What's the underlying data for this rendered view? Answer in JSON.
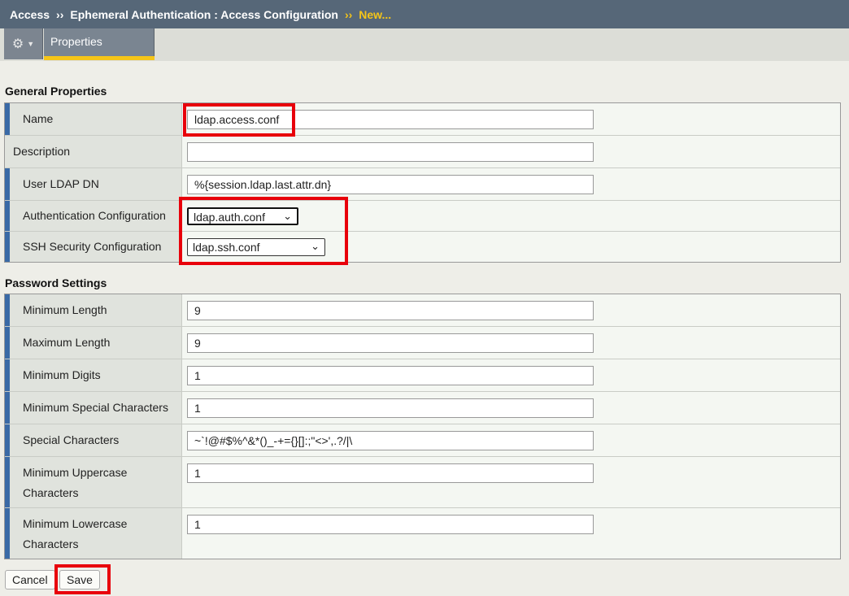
{
  "breadcrumb": {
    "root": "Access",
    "separator": "››",
    "parent": "Ephemeral Authentication : Access Configuration",
    "current": "New..."
  },
  "tabs": {
    "gear_icon": "gear-icon",
    "active_label": "Properties"
  },
  "general": {
    "title": "General Properties",
    "name_label": "Name",
    "name_value": "ldap.access.conf",
    "description_label": "Description",
    "description_value": "",
    "user_ldap_dn_label": "User LDAP DN",
    "user_ldap_dn_value": "%{session.ldap.last.attr.dn}",
    "auth_config_label": "Authentication Configuration",
    "auth_config_value": "ldap.auth.conf",
    "ssh_config_label": "SSH Security Configuration",
    "ssh_config_value": "ldap.ssh.conf"
  },
  "password": {
    "title": "Password Settings",
    "min_length_label": "Minimum Length",
    "min_length_value": "9",
    "max_length_label": "Maximum Length",
    "max_length_value": "9",
    "min_digits_label": "Minimum Digits",
    "min_digits_value": "1",
    "min_special_label": "Minimum Special Characters",
    "min_special_value": "1",
    "special_chars_label": "Special Characters",
    "special_chars_value": "~`!@#$%^&*()_-+={}[]:;\"<>',.?/|\\",
    "min_upper_label_1": "Minimum Uppercase",
    "min_upper_label_2": "Characters",
    "min_upper_value": "1",
    "min_lower_label_1": "Minimum Lowercase",
    "min_lower_label_2": "Characters",
    "min_lower_value": "1"
  },
  "actions": {
    "cancel_label": "Cancel",
    "save_label": "Save"
  },
  "colors": {
    "header_bg": "#566778",
    "accent_yellow": "#f5c518",
    "highlight_red": "#e8000b",
    "required_marker": "#3a6aa6"
  }
}
